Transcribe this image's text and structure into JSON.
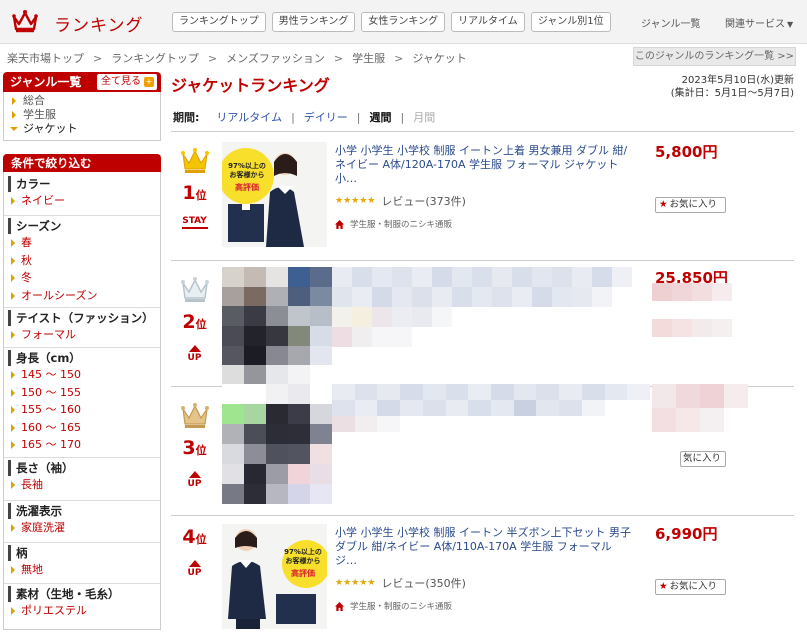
{
  "header": {
    "logo_text": "ランキング",
    "tabs": [
      "ランキングトップ",
      "男性ランキング",
      "女性ランキング",
      "リアルタイム",
      "ジャンル別1位"
    ],
    "genre_list": "ジャンル一覧",
    "related": "関連サービス",
    "related_caret": "▼"
  },
  "breadcrumb": [
    "楽天市場トップ",
    "ランキングトップ",
    "メンズファッション",
    "学生服",
    "ジャケット"
  ],
  "breadcrumb_sep": ">",
  "genre_ranking_link": "このジャンルのランキング一覧 >>",
  "sidebar": {
    "genre_title": "ジャンル一覧",
    "see_all": "全て見る",
    "see_all_plus": "+",
    "genres": [
      "総合",
      "学生服",
      "ジャケット"
    ],
    "filter_title": "条件で絞り込む",
    "filters": [
      {
        "title": "カラー",
        "items": [
          "ネイビー"
        ]
      },
      {
        "title": "シーズン",
        "items": [
          "春",
          "秋",
          "冬",
          "オールシーズン"
        ]
      },
      {
        "title": "テイスト（ファッション）",
        "items": [
          "フォーマル"
        ]
      },
      {
        "title": "身長（cm）",
        "items": [
          "145 ～ 150",
          "150 ～ 155",
          "155 ～ 160",
          "160 ～ 165",
          "165 ～ 170"
        ]
      },
      {
        "title": "長さ（袖）",
        "items": [
          "長袖"
        ]
      },
      {
        "title": "洗濯表示",
        "items": [
          "家庭洗濯"
        ]
      },
      {
        "title": "柄",
        "items": [
          "無地"
        ]
      },
      {
        "title": "素材（生地・毛糸）",
        "items": [
          "ポリエステル"
        ]
      }
    ]
  },
  "main": {
    "title": "ジャケットランキング",
    "updated_line1": "2023年5月10日(水)更新",
    "updated_line2": "(集計日：5月1日～5月7日)",
    "period_label": "期間:",
    "periods": [
      "リアルタイム",
      "デイリー",
      "週間",
      "月間"
    ],
    "period_sep": "|",
    "selected_period": "週間"
  },
  "items": [
    {
      "rank": "1",
      "rank_unit": "位",
      "change": "STAY",
      "title": "小学 小学生 小学校 制服 イートン上着 男女兼用 ダブル 紺/ネイビー A体/120A-170A 学生服 フォーマル ジャケット 小…",
      "stars": "★★★★★",
      "review": "レビュー(373件)",
      "shop": "学生服・制服のニシキ通販",
      "price": "5,800円",
      "fav_star": "★",
      "fav": "お気に入り",
      "badge": {
        "line1": "97%以上の",
        "line2": "お客様から",
        "line3": "高評価"
      }
    },
    {
      "rank": "2",
      "rank_unit": "位",
      "change": "UP",
      "price_partial": "25,850円"
    },
    {
      "rank": "3",
      "rank_unit": "位",
      "change": "UP",
      "fav_partial": "気に入り"
    },
    {
      "rank": "4",
      "rank_unit": "位",
      "change": "UP",
      "title": "小学 小学生 小学校 制服 イートン 半ズボン上下セット 男子 ダブル 紺/ネイビー A体/110A-170A 学生服 フォーマル ジ…",
      "stars": "★★★★★",
      "review": "レビュー(350件)",
      "shop": "学生服・制服のニシキ通販",
      "price": "6,990円",
      "fav_star": "★",
      "fav": "お気に入り",
      "badge": {
        "line1": "97%以上の",
        "line2": "お客様から",
        "line3": "高評価"
      }
    }
  ],
  "colors": {
    "brand": "#bf0000",
    "gold": "#e0a000",
    "silver": "#b8c4cc",
    "bronze": "#c49a52",
    "link": "#2a4b8d"
  }
}
